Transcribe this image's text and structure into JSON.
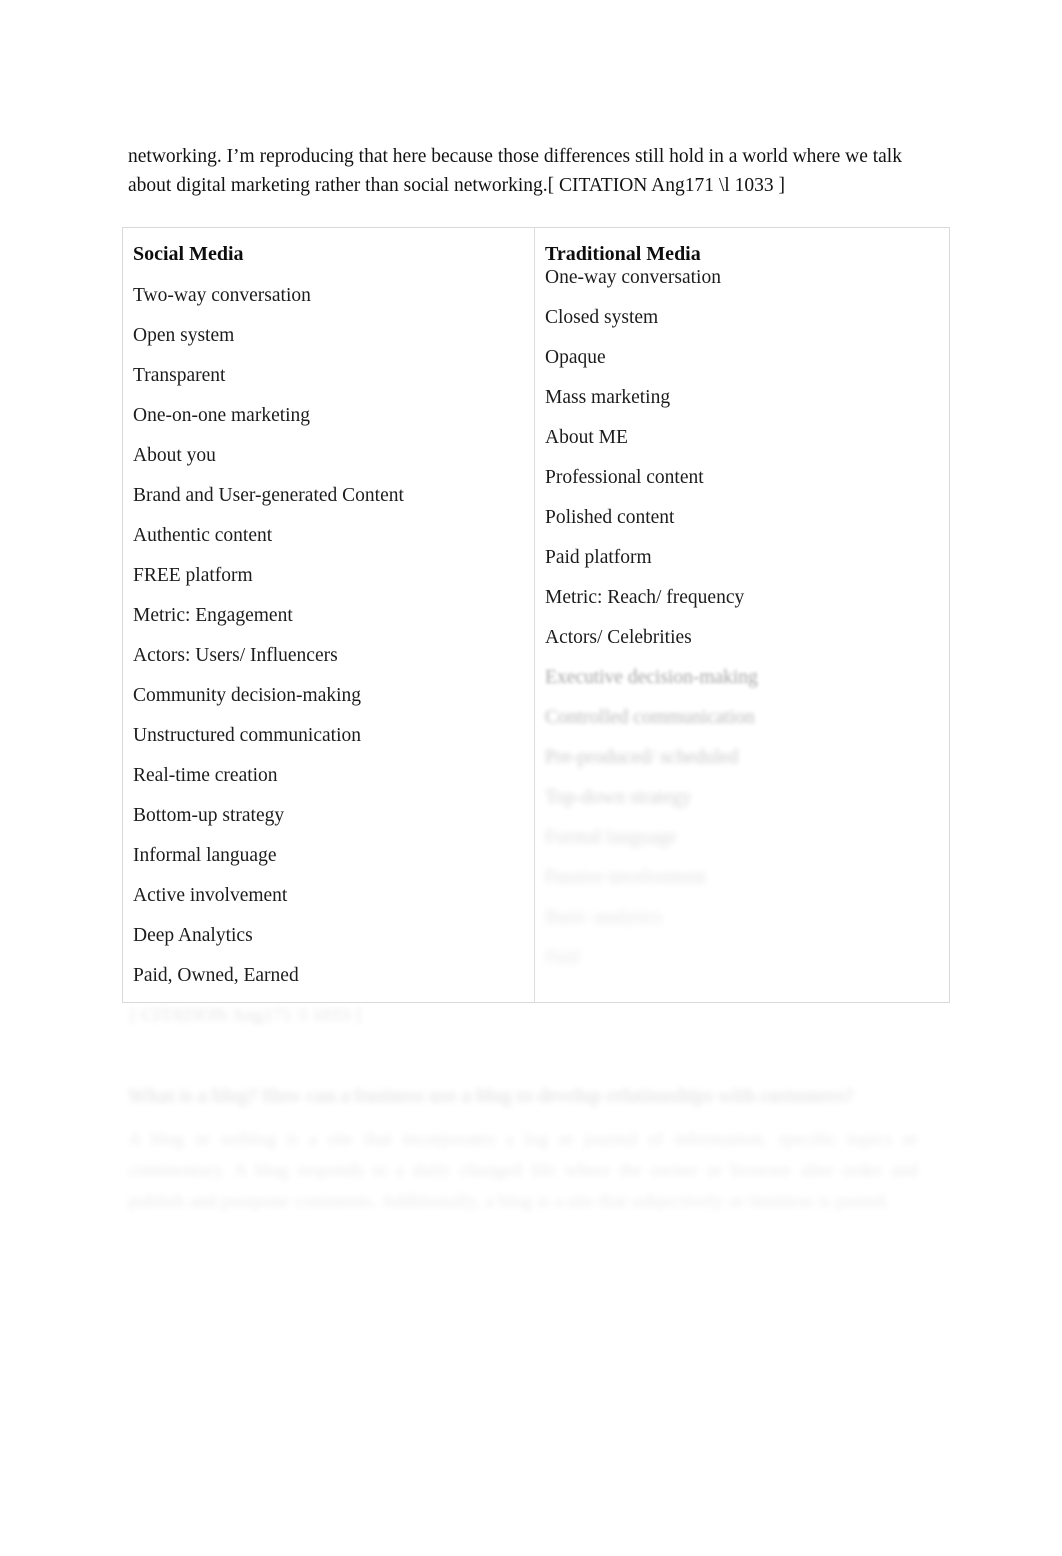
{
  "document": {
    "intro_paragraph": "networking. I’m reproducing that here because those differences still hold in a world where we talk about digital marketing rather than social networking.[ CITATION Ang171 \\l 1033 ]",
    "table": {
      "left_column": {
        "header": "Social Media",
        "items": [
          "Two-way conversation",
          "Open system",
          "Transparent",
          "One-on-one marketing",
          "About you",
          "Brand and User-generated Content",
          "Authentic content",
          "FREE platform",
          "Metric: Engagement",
          "Actors: Users/ Influencers",
          "Community decision-making",
          "Unstructured communication",
          "Real-time creation",
          "Bottom-up strategy",
          "Informal language",
          "Active involvement",
          "Deep Analytics",
          "Paid, Owned, Earned"
        ]
      },
      "right_column": {
        "header": "Traditional Media",
        "items": [
          "One-way conversation",
          "Closed system",
          "Opaque",
          "Mass marketing",
          "About ME",
          "Professional content",
          "Polished content",
          "Paid platform",
          "Metric: Reach/ frequency",
          "Actors/ Celebrities",
          "Executive decision-making",
          "Controlled communication",
          "Pre-produced/ scheduled",
          "Top-down strategy",
          "Formal language",
          "Passive involvement",
          "Basic analytics",
          "Paid"
        ]
      }
    },
    "below_table": {
      "caption": "[ CITATION Ang171 \\l 1033 ]",
      "heading": "What is a blog? How can a business use a blog to develop relationships with customers?",
      "body": "A blog or weblog is a site that incorporates a log or journal of information, specific topics or commentary. A blog responds to a daily changed life where the owner or browser alter order and publish and postpone comments. Additionally, a blog is a site that subjectively or limitless is posted."
    }
  }
}
